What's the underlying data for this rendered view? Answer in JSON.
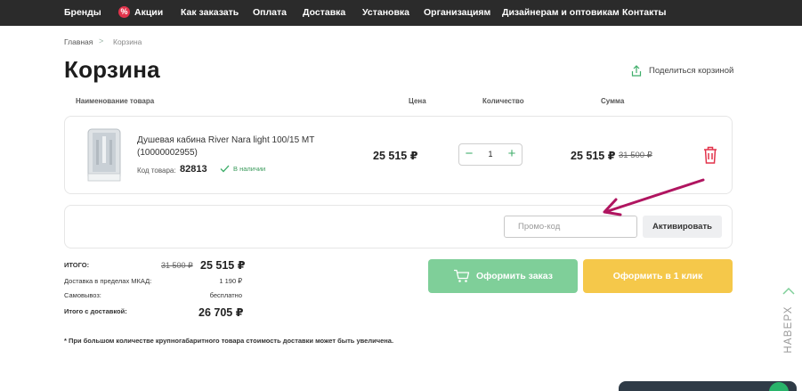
{
  "nav": {
    "items": [
      "Бренды",
      "Акции",
      "Как заказать",
      "Оплата",
      "Доставка",
      "Установка",
      "Организациям",
      "Дизайнерам и оптовикам",
      "Контакты"
    ],
    "promo_icon": "percent-icon"
  },
  "breadcrumb": {
    "home": "Главная",
    "separator": ">",
    "current": "Корзина"
  },
  "page": {
    "title": "Корзина",
    "share_label": "Поделиться корзиной"
  },
  "table": {
    "headers": {
      "name": "Наименование товара",
      "price": "Цена",
      "quantity": "Количество",
      "sum": "Сумма"
    }
  },
  "item": {
    "name": "Душевая кабина River Nara light 100/15 МТ (10000002955)",
    "code_label": "Код товара:",
    "code": "82813",
    "stock": "В наличии",
    "price": "25 515 ₽",
    "quantity": "1",
    "sum": "25 515 ₽",
    "old_sum": "31 500 ₽"
  },
  "promo": {
    "placeholder": "Промо-код",
    "button": "Активировать"
  },
  "totals": {
    "total_label": "ИТОГО:",
    "total_old": "31 500 ₽",
    "total": "25 515 ₽",
    "delivery_label": "Доставка в пределах МКАД:",
    "delivery_value": "1 190 ₽",
    "pickup_label": "Самовывоз:",
    "pickup_value": "бесплатно",
    "with_delivery_label": "Итого с доставкой:",
    "with_delivery": "26 705 ₽"
  },
  "actions": {
    "order": "Оформить заказ",
    "one_click": "Оформить в 1 клик"
  },
  "note": "* При большом количестве крупногабаритного товара стоимость доставки может быть увеличена.",
  "scroll_top": "НАВЕРХ",
  "colors": {
    "green": "#7fcf99",
    "yellow": "#f5c84a",
    "nav_bg": "#2b2b2b",
    "arrow": "#b01560",
    "trash": "#e2334b"
  }
}
